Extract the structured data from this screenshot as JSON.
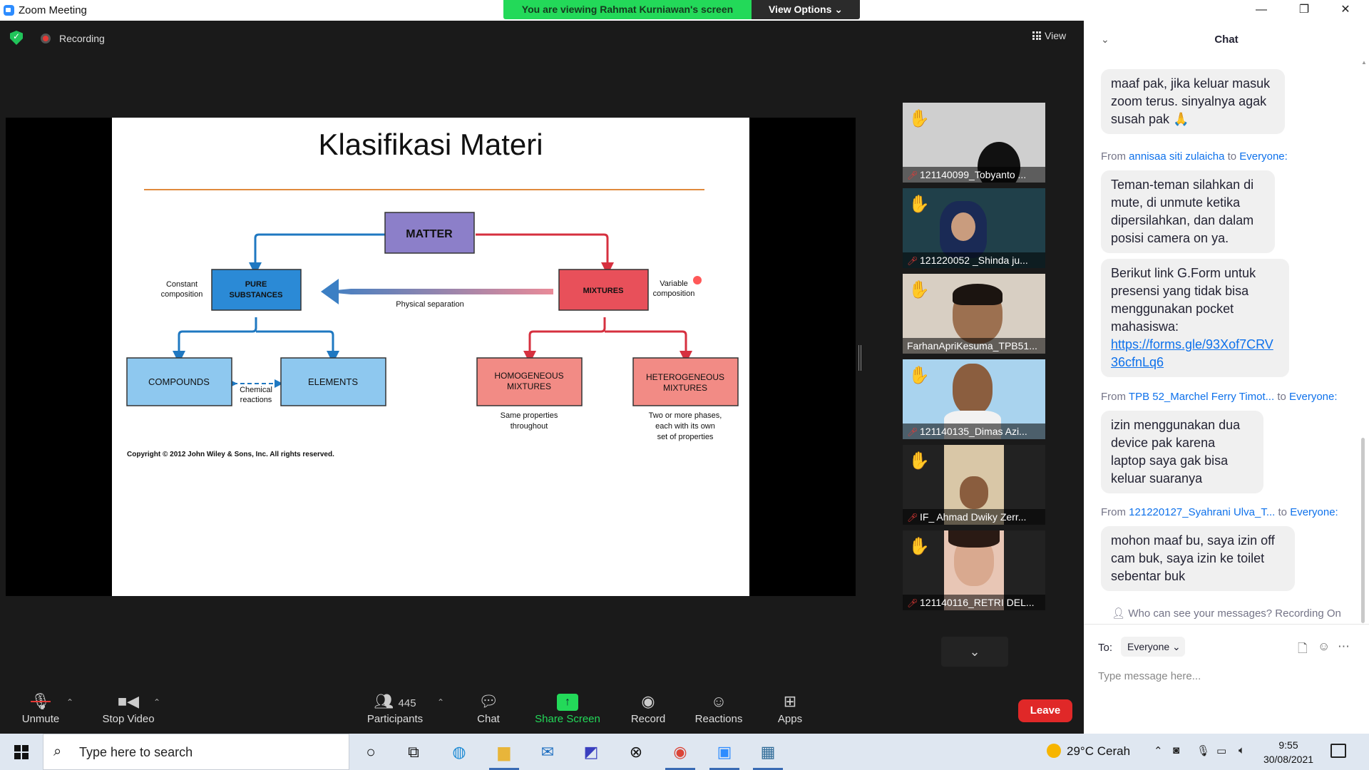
{
  "window": {
    "title": "Zoom Meeting",
    "minimize": "—",
    "maximize": "❐",
    "close": "✕"
  },
  "banner": {
    "viewing": "You are viewing Rahmat Kurniawan's screen",
    "view_options": "View Options ⌄"
  },
  "meeting": {
    "recording_label": "Recording",
    "view_label": "View"
  },
  "slide": {
    "title": "Klasifikasi Materi",
    "copyright": "Copyright © 2012 John Wiley & Sons, Inc. All rights reserved.",
    "nodes": {
      "matter": "MATTER",
      "pure_1": "PURE",
      "pure_2": "SUBSTANCES",
      "mixtures": "MIXTURES",
      "compounds": "COMPOUNDS",
      "elements": "ELEMENTS",
      "homo_1": "HOMOGENEOUS",
      "homo_2": "MIXTURES",
      "hetero_1": "HETEROGENEOUS",
      "hetero_2": "MIXTURES"
    },
    "labels": {
      "constant_1": "Constant",
      "constant_2": "composition",
      "variable_1": "Variable",
      "variable_2": "composition",
      "physical": "Physical separation",
      "chemical_1": "Chemical",
      "chemical_2": "reactions",
      "homo_desc_1": "Same properties",
      "homo_desc_2": "throughout",
      "hetero_desc_1": "Two or more phases,",
      "hetero_desc_2": "each with its own",
      "hetero_desc_3": "set of properties"
    }
  },
  "participants": [
    {
      "name": "121140099_Tobyanto ...",
      "hand": "✋",
      "hand_color": "#5a4a3e"
    },
    {
      "name": "121220052 _Shinda ju...",
      "hand": "✋",
      "hand_color": "#f5b800"
    },
    {
      "name": "FarhanApriKesuma_TPB51...",
      "hand": "✋",
      "hand_color": "#f5b800"
    },
    {
      "name": "121140135_Dimas Azi...",
      "hand": "✋",
      "hand_color": "#f5b800"
    },
    {
      "name": "IF_ Ahmad Dwiky Zerr...",
      "hand": "✋",
      "hand_color": "#f5b800"
    },
    {
      "name": "121140116_RETRI DEL...",
      "hand": "✋",
      "hand_color": "#f5b800"
    }
  ],
  "toolbar": {
    "unmute": "Unmute",
    "stop_video": "Stop Video",
    "participants_count": "445",
    "participants": "Participants",
    "chat": "Chat",
    "share_screen": "Share Screen",
    "record": "Record",
    "reactions": "Reactions",
    "apps": "Apps",
    "leave": "Leave"
  },
  "chat": {
    "title": "Chat",
    "messages": [
      {
        "text": "maaf pak, jika keluar masuk zoom terus. sinyalnya agak susah pak 🙏"
      },
      {
        "from_prefix": "From",
        "from_name": "annisaa siti zulaicha",
        "to_word": "to",
        "to_name": "Everyone:"
      },
      {
        "text": "Teman-teman silahkan di mute, di unmute ketika dipersilahkan, dan dalam posisi camera on ya."
      },
      {
        "text": "Berikut link G.Form untuk presensi yang tidak bisa menggunakan pocket mahasiswa:",
        "link": "https://forms.gle/93Xof7CRV36cfnLq6"
      },
      {
        "from_prefix": "From",
        "from_name": "TPB 52_Marchel Ferry Timot...",
        "to_word": "to",
        "to_name": "Everyone:"
      },
      {
        "text": "izin menggunakan dua device pak karena laptop saya gak bisa keluar suaranya"
      },
      {
        "from_prefix": "From",
        "from_name": "121220127_Syahrani Ulva_T...",
        "to_word": "to",
        "to_name": "Everyone:"
      },
      {
        "text": "mohon maaf bu, saya izin off cam buk, saya izin ke toilet sebentar buk"
      }
    ],
    "privacy": "Who can see your messages? Recording On",
    "to_label": "To:",
    "to_value": "Everyone",
    "placeholder": "Type message here..."
  },
  "taskbar": {
    "search_placeholder": "Type here to search",
    "weather_temp": "29°C",
    "weather_text": "Cerah",
    "time": "9:55",
    "date": "30/08/2021"
  }
}
